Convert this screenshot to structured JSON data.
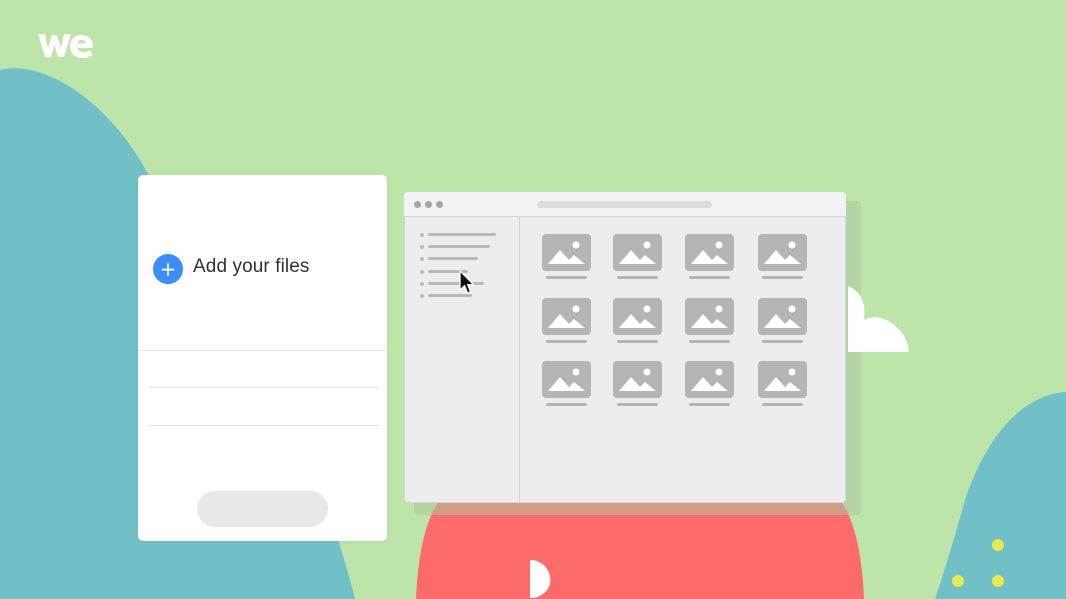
{
  "brand": {
    "logo_text": "we",
    "logo_icon": "wetransfer-logo-icon"
  },
  "colors": {
    "background": "#bde5a9",
    "teal_blob": "#72c0c7",
    "red_blob": "#fd6a6a",
    "accent_blue": "#3a8dfb",
    "dots_yellow": "#e6ea4d"
  },
  "upload_panel": {
    "add_files_icon": "plus-icon",
    "add_files_label": "Add your files"
  },
  "browser_window": {
    "window_controls": [
      "window-dot-icon",
      "window-dot-icon",
      "window-dot-icon"
    ],
    "sidebar_items": 6,
    "thumbnail_icon": "image-placeholder-icon",
    "thumbnail_grid": {
      "rows": 3,
      "columns": 4
    }
  },
  "cursor": "mouse-pointer-icon"
}
